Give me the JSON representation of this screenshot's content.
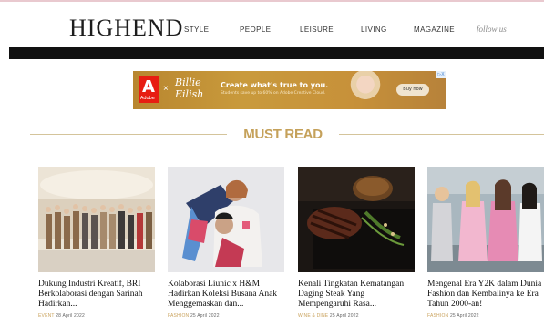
{
  "brand": {
    "logo": "HIGHEND"
  },
  "nav": {
    "items": [
      "STYLE",
      "PEOPLE",
      "LEISURE",
      "LIVING",
      "MAGAZINE"
    ],
    "follow": "follow us"
  },
  "ad": {
    "adobe_logo": "Adobe",
    "x": "×",
    "script": "Billie\nEilish",
    "headline": "Create what's true to you.",
    "sub": "Students save up to 60% on Adobe Creative Cloud.",
    "button": "Buy now",
    "close": "▷X"
  },
  "section": {
    "title": "MUST READ"
  },
  "cards": [
    {
      "title": "Dukung Industri Kreatif, BRI Berkolaborasi dengan Sarinah Hadirkan...",
      "category": "EVENT",
      "date": "28 April 2022"
    },
    {
      "title": "Kolaborasi Liunic x H&M Hadirkan Koleksi Busana Anak Menggemaskan dan...",
      "category": "FASHION",
      "date": "25 April 2022"
    },
    {
      "title": "Kenali Tingkatan Kematangan Daging Steak Yang Mempengaruhi Rasa...",
      "category": "WINE & DINE",
      "date": "25 April 2022"
    },
    {
      "title": "Mengenal Era Y2K dalam Dunia Fashion dan Kembalinya ke Era Tahun 2000-an!",
      "category": "FASHION",
      "date": "25 April 2022"
    }
  ]
}
